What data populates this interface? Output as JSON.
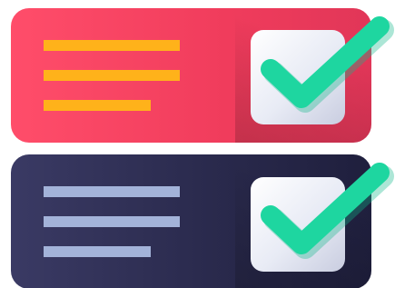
{
  "colors": {
    "top_card": "#f0405f",
    "bottom_card": "#2a2a4d",
    "top_lines": "#ffb21a",
    "bottom_lines": "#a3b3d9",
    "check": "#1ed6a0",
    "checkbox": "#eef0f7"
  },
  "icons": {
    "top_check": "checkmark-icon",
    "bottom_check": "checkmark-icon"
  }
}
